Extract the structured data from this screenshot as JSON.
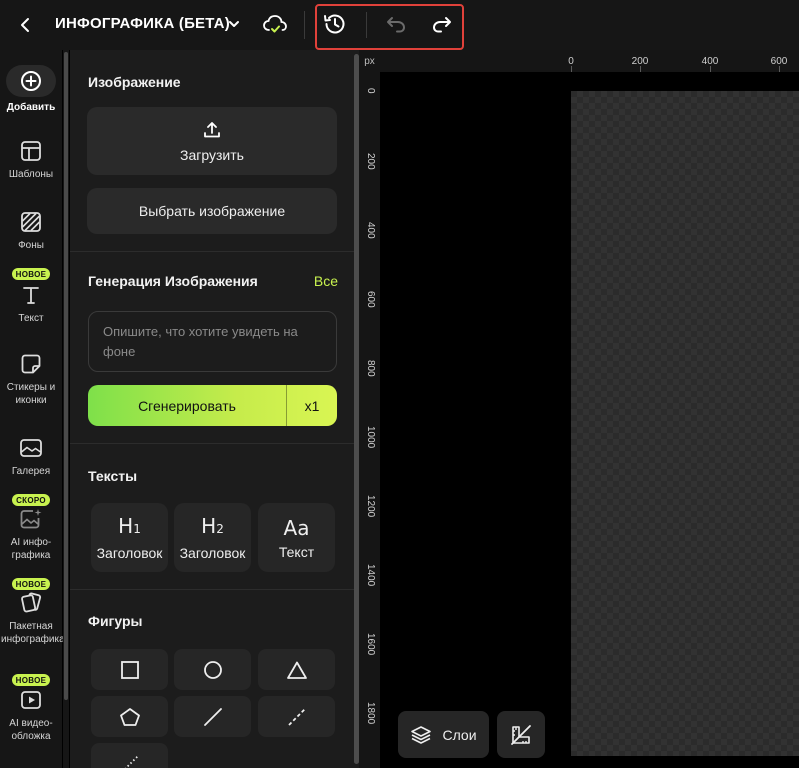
{
  "topbar": {
    "title": "ИНФОГРАФИКА (БЕТА)"
  },
  "rail": {
    "items": [
      {
        "label": "Добавить",
        "icon": "plus-circle-icon",
        "active": true
      },
      {
        "label": "Шаблоны",
        "icon": "template-icon"
      },
      {
        "label": "Фоны",
        "icon": "background-pattern-icon"
      },
      {
        "label": "Текст",
        "icon": "text-icon",
        "badge": "НОВОЕ"
      },
      {
        "label": "Стикеры и иконки",
        "icon": "sticker-icon"
      },
      {
        "label": "Галерея",
        "icon": "gallery-icon"
      },
      {
        "label": "AI инфо-графика",
        "icon": "ai-image-icon",
        "badge": "СКОРО"
      },
      {
        "label": "Пакетная инфографика",
        "icon": "batch-cards-icon",
        "badge": "НОВОЕ"
      },
      {
        "label": "AI видео-обложка",
        "icon": "video-play-icon",
        "badge": "НОВОЕ"
      }
    ]
  },
  "panel": {
    "image_section": {
      "title": "Изображение",
      "upload_label": "Загрузить",
      "choose_label": "Выбрать изображение"
    },
    "generation_section": {
      "title": "Генерация Изображения",
      "all_link": "Все",
      "prompt_placeholder": "Опишите, что хотите увидеть на фоне",
      "generate_label": "Сгенерировать",
      "multiplier": "x1"
    },
    "texts_section": {
      "title": "Тексты",
      "cards": [
        {
          "glyph": "H",
          "sub": "1",
          "label": "Заголовок"
        },
        {
          "glyph": "H",
          "sub": "2",
          "label": "Заголовок"
        },
        {
          "glyph": "Aa",
          "sub": "",
          "label": "Текст"
        }
      ]
    },
    "shapes_section": {
      "title": "Фигуры",
      "shapes": [
        "square-icon",
        "circle-icon",
        "triangle-icon",
        "pentagon-icon",
        "line-icon",
        "dashed-line-icon",
        "dotted-line-icon"
      ]
    }
  },
  "canvas": {
    "unit": "px",
    "ruler_top": [
      "0",
      "200",
      "400",
      "600"
    ],
    "ruler_left": [
      "0",
      "200",
      "400",
      "600",
      "800",
      "1000",
      "1200",
      "1400",
      "1600",
      "1800"
    ],
    "layers_label": "Слои"
  },
  "colors": {
    "accent": "#c8f24f",
    "highlight": "#e0413a"
  }
}
